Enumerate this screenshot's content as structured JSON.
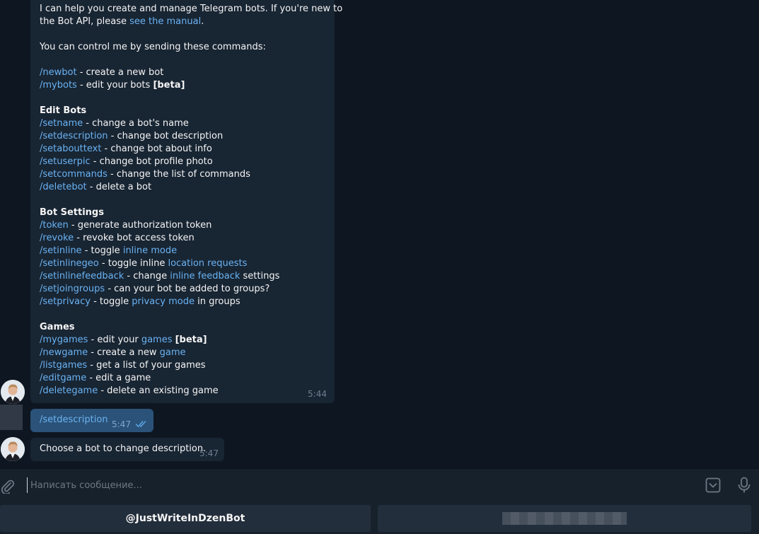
{
  "messages": {
    "bot_help": {
      "intro1": "I can help you create and manage Telegram bots. If you're new to",
      "intro2_prefix": "the Bot API, please ",
      "intro2_link": "see the manual",
      "intro2_suffix": ".",
      "control": "You can control me by sending these commands:",
      "newbot_cmd": "/newbot",
      "newbot_desc": " - create a new bot",
      "mybots_cmd": "/mybots",
      "mybots_desc": " - edit your bots ",
      "mybots_beta": "[beta]",
      "edit_heading": "Edit Bots",
      "setname_cmd": "/setname",
      "setname_desc": " - change a bot's name",
      "setdescription_cmd": "/setdescription",
      "setdescription_desc": " - change bot description",
      "setabouttext_cmd": "/setabouttext",
      "setabouttext_desc": " - change bot about info",
      "setuserpic_cmd": "/setuserpic",
      "setuserpic_desc": " - change bot profile photo",
      "setcommands_cmd": "/setcommands",
      "setcommands_desc": " - change the list of commands",
      "deletebot_cmd": "/deletebot",
      "deletebot_desc": " - delete a bot",
      "settings_heading": "Bot Settings",
      "token_cmd": "/token",
      "token_desc": " - generate authorization token",
      "revoke_cmd": "/revoke",
      "revoke_desc": " - revoke bot access token",
      "setinline_cmd": "/setinline",
      "setinline_desc": " - toggle ",
      "setinline_link": "inline mode",
      "setinlinegeo_cmd": "/setinlinegeo",
      "setinlinegeo_desc": " - toggle inline ",
      "setinlinegeo_link": "location requests",
      "setinlinefeedback_cmd": "/setinlinefeedback",
      "setinlinefeedback_desc": " - change ",
      "setinlinefeedback_link": "inline feedback",
      "setinlinefeedback_suffix": " settings",
      "setjoingroups_cmd": "/setjoingroups",
      "setjoingroups_desc": " - can your bot be added to groups?",
      "setprivacy_cmd": "/setprivacy",
      "setprivacy_desc": " - toggle ",
      "setprivacy_link": "privacy mode",
      "setprivacy_suffix": " in groups",
      "games_heading": "Games",
      "mygames_cmd": "/mygames",
      "mygames_desc": " - edit your ",
      "mygames_link": "games",
      "mygames_beta": "[beta]",
      "newgame_cmd": "/newgame",
      "newgame_desc": " - create a new ",
      "newgame_link": "game",
      "listgames_cmd": "/listgames",
      "listgames_desc": " - get a list of your games",
      "editgame_cmd": "/editgame",
      "editgame_desc": " - edit a game",
      "deletegame_cmd": "/deletegame",
      "deletegame_desc": " - delete an existing game",
      "time": "5:44"
    },
    "user_cmd": {
      "text": "/setdescription",
      "time": "5:47"
    },
    "bot_reply": {
      "text": "Choose a bot to change description.",
      "time": "5:47"
    }
  },
  "input": {
    "placeholder": "Написать сообщение..."
  },
  "icons": {
    "attach": "paperclip-icon",
    "bot_keyboard": "keyboard-toggle-icon",
    "voice": "microphone-icon",
    "read": "double-check-icon"
  },
  "keyboard": {
    "button1": "@JustWriteInDzenBot"
  },
  "colors": {
    "background": "#0e1621",
    "incoming_bubble": "#182533",
    "outgoing_bubble": "#2b5278",
    "link": "#6ab3f3",
    "panel": "#17212b",
    "key_button": "#232e3c"
  }
}
